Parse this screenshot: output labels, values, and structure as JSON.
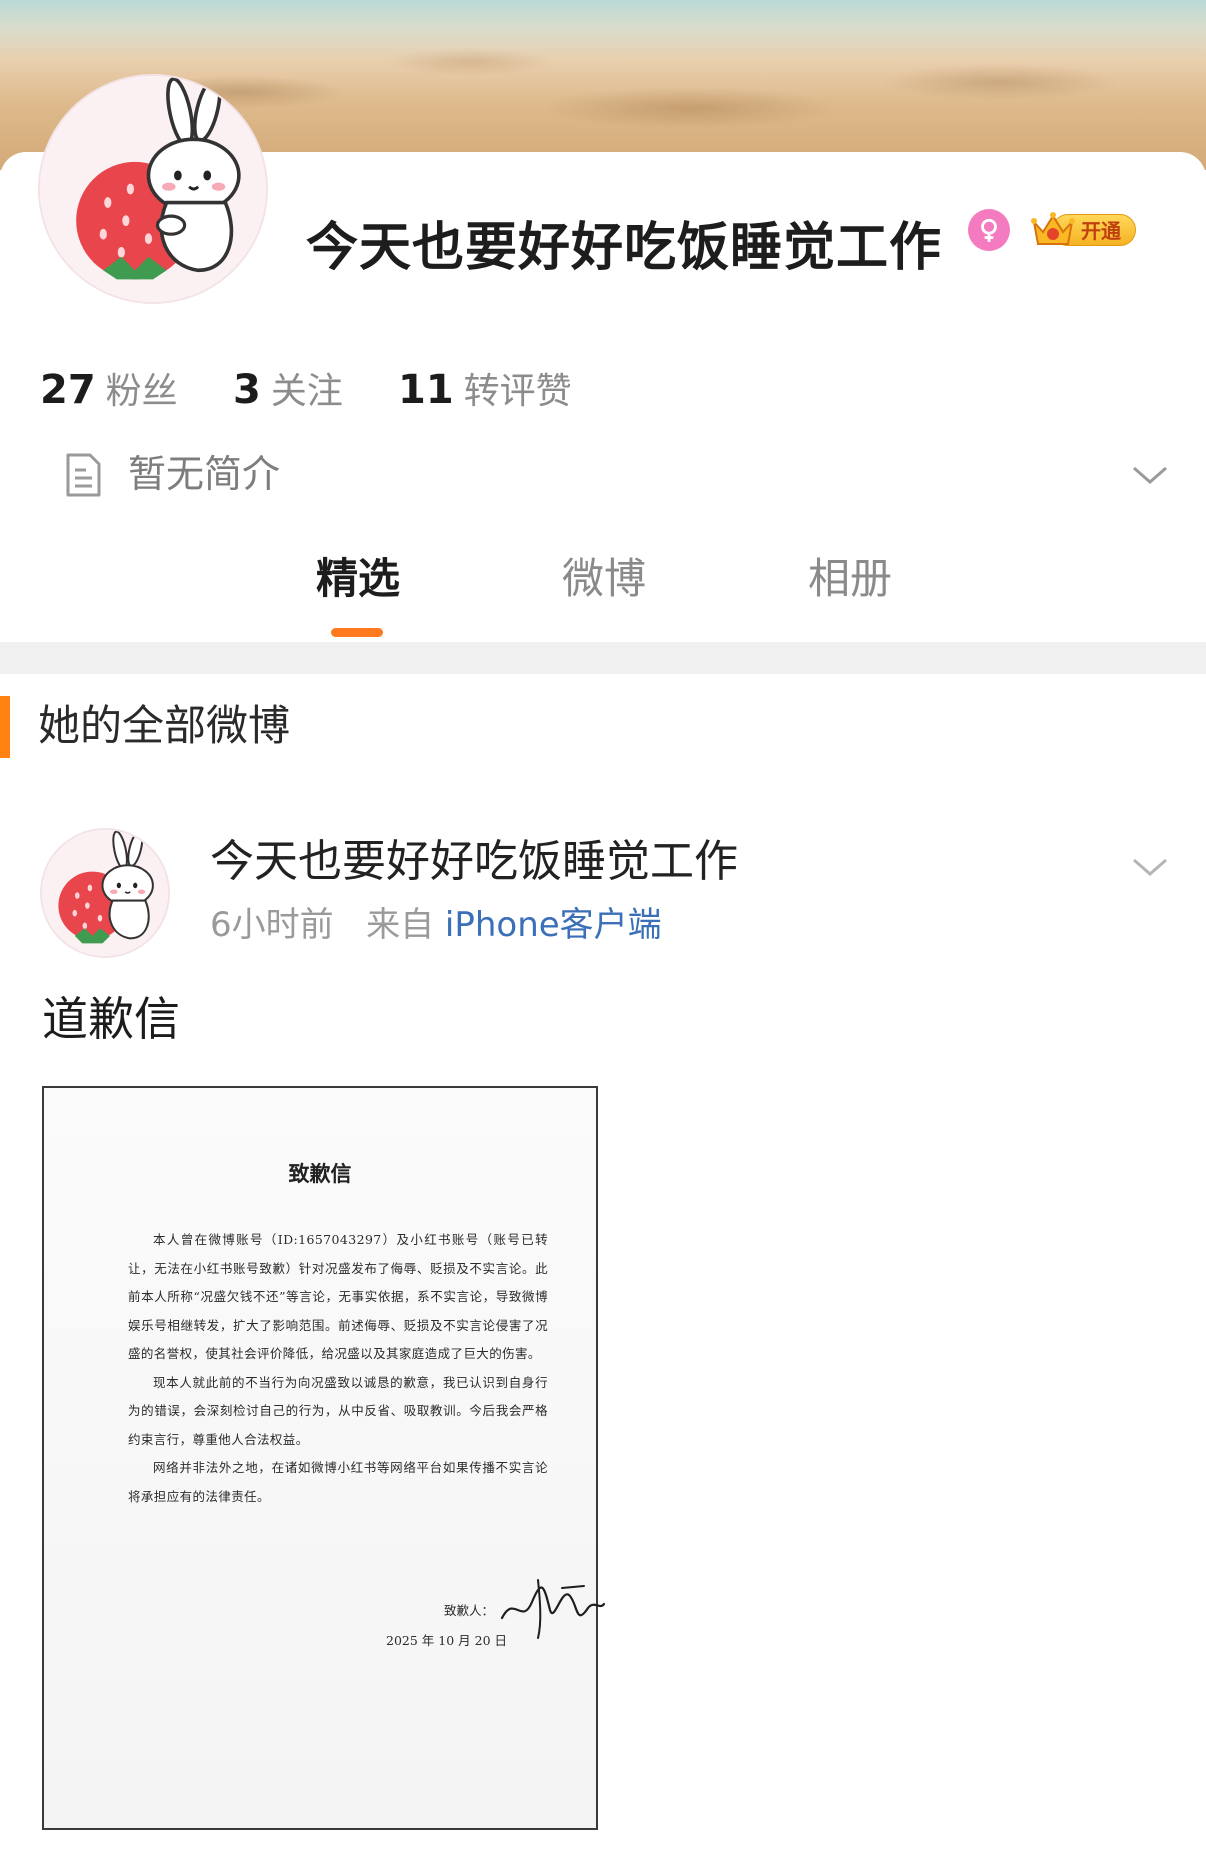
{
  "profile": {
    "username": "今天也要好好吃饭睡觉工作",
    "vip_label": "开通",
    "stats": [
      {
        "value": "27",
        "label": "粉丝"
      },
      {
        "value": "3",
        "label": "关注"
      },
      {
        "value": "11",
        "label": "转评赞"
      }
    ],
    "bio": "暂无简介"
  },
  "tabs": [
    {
      "label": "精选",
      "active": true
    },
    {
      "label": "微博",
      "active": false
    },
    {
      "label": "相册",
      "active": false
    }
  ],
  "section": {
    "title": "她的全部微博"
  },
  "post": {
    "author": "今天也要好好吃饭睡觉工作",
    "time": "6小时前",
    "source_prefix": "来自",
    "source": "iPhone客户端",
    "text": "道歉信",
    "image": {
      "title": "致歉信",
      "paragraphs": [
        "本人曾在微博账号（ID:1657043297）及小红书账号（账号已转让，无法在小红书账号致歉）针对况盛发布了侮辱、贬损及不实言论。此前本人所称“况盛欠钱不还”等言论，无事实依据，系不实言论，导致微博娱乐号相继转发，扩大了影响范围。前述侮辱、贬损及不实言论侵害了况盛的名誉权，使其社会评价降低，给况盛以及其家庭造成了巨大的伤害。",
        "现本人就此前的不当行为向况盛致以诚恳的歉意，我已认识到自身行为的错误，会深刻检讨自己的行为，从中反省、吸取教训。今后我会严格约束言行，尊重他人合法权益。",
        "网络并非法外之地，在诸如微博小红书等网络平台如果传播不实言论将承担应有的法律责任。"
      ],
      "signer_label": "致歉人：",
      "date": "2025 年 10 月 20 日"
    }
  },
  "colors": {
    "accent_orange": "#ff7a1f",
    "link_blue": "#3b6fb7",
    "female_pink": "#f47bc0"
  }
}
